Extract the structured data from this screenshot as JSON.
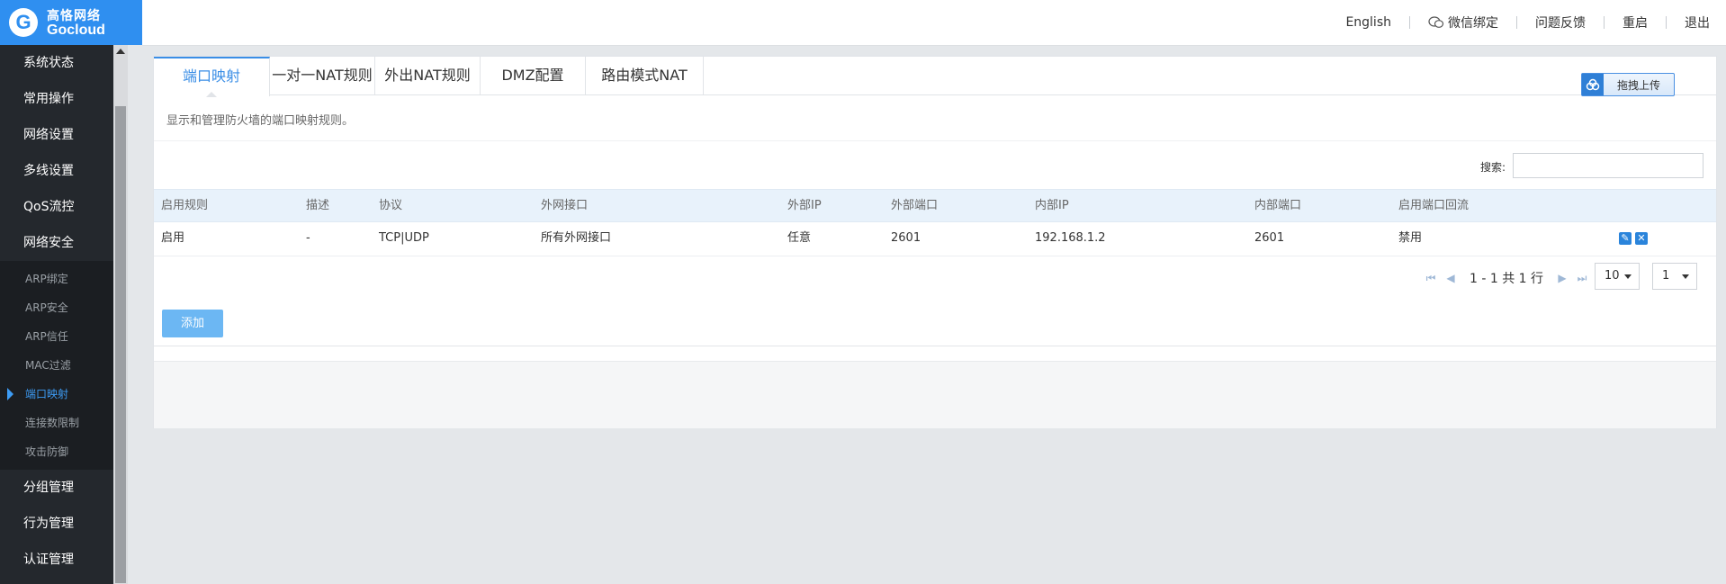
{
  "brand": {
    "cn": "高恪网络",
    "en": "Gocloud"
  },
  "header": {
    "links": [
      "English",
      "微信绑定",
      "问题反馈",
      "重启",
      "退出"
    ]
  },
  "sidebar": {
    "items": [
      "系统状态",
      "常用操作",
      "网络设置",
      "多线设置",
      "QoS流控",
      "网络安全"
    ],
    "subitems": [
      "ARP绑定",
      "ARP安全",
      "ARP信任",
      "MAC过滤",
      "端口映射",
      "连接数限制",
      "攻击防御"
    ],
    "active_sub": "端口映射",
    "items_after": [
      "分组管理",
      "行为管理",
      "认证管理"
    ]
  },
  "tabs": [
    "端口映射",
    "一对一NAT规则",
    "外出NAT规则",
    "DMZ配置",
    "路由模式NAT"
  ],
  "active_tab": "端口映射",
  "upload_label": "拖拽上传",
  "description": "显示和管理防火墙的端口映射规则。",
  "search": {
    "label": "搜索:",
    "value": ""
  },
  "table": {
    "columns": [
      "启用规则",
      "描述",
      "协议",
      "外网接口",
      "外部IP",
      "外部端口",
      "内部IP",
      "内部端口",
      "启用端口回流"
    ],
    "rows": [
      [
        "启用",
        "-",
        "TCP|UDP",
        "所有外网接口",
        "任意",
        "2601",
        "192.168.1.2",
        "2601",
        "禁用"
      ]
    ]
  },
  "pagination": {
    "summary": "1 - 1 共 1 行",
    "page_size": "10",
    "page": "1"
  },
  "add_label": "添加",
  "colors": {
    "accent": "#3a8ee6",
    "sidebar": "#24282d",
    "button": "#6cb7f3"
  }
}
